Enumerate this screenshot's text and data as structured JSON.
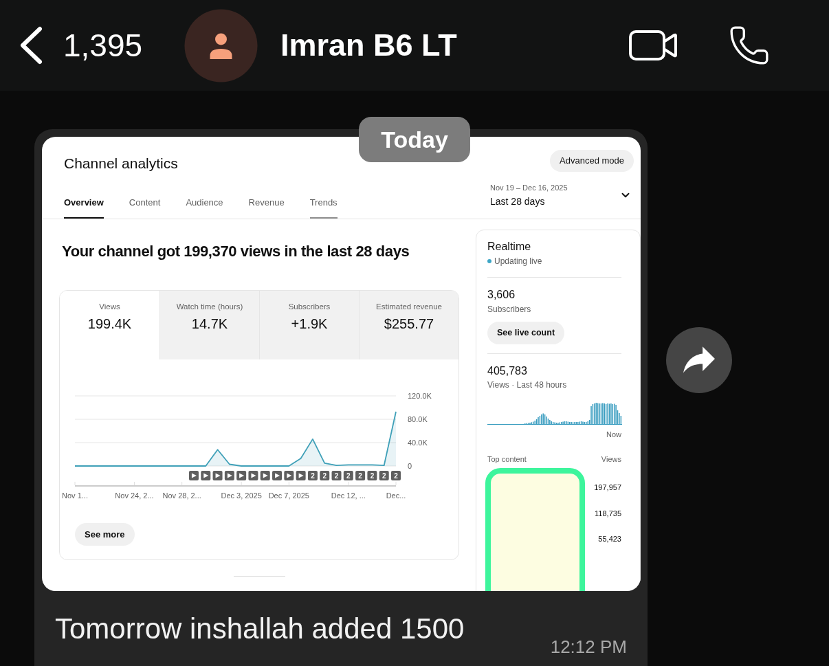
{
  "chat_header": {
    "back_count": "1,395",
    "contact_name": "Imran B6 LT"
  },
  "date_chip": "Today",
  "message": {
    "analytics_screenshot": {
      "title": "Channel analytics",
      "advanced_mode_button": "Advanced mode",
      "date_range": {
        "dates": "Nov 19 – Dec 16, 2025",
        "period": "Last 28 days"
      },
      "tabs": [
        {
          "label": "Overview",
          "selected": true,
          "hovered": false
        },
        {
          "label": "Content",
          "selected": false,
          "hovered": false
        },
        {
          "label": "Audience",
          "selected": false,
          "hovered": false
        },
        {
          "label": "Revenue",
          "selected": false,
          "hovered": false
        },
        {
          "label": "Trends",
          "selected": false,
          "hovered": true
        }
      ],
      "headline": "Your channel got 199,370 views in the last 28 days",
      "metrics": [
        {
          "label": "Views",
          "value": "199.4K",
          "selected": true
        },
        {
          "label": "Watch time (hours)",
          "value": "14.7K",
          "selected": false
        },
        {
          "label": "Subscribers",
          "value": "+1.9K",
          "selected": false
        },
        {
          "label": "Estimated revenue",
          "value": "$255.77",
          "selected": false
        }
      ],
      "chart_data": {
        "type": "area",
        "categories": [
          "Nov 1...",
          null,
          null,
          null,
          null,
          "Nov 24, 2...",
          null,
          null,
          null,
          "Nov 28, 2...",
          null,
          null,
          null,
          null,
          "Dec 3, 2025",
          null,
          null,
          null,
          "Dec 7, 2025",
          null,
          null,
          null,
          null,
          "Dec 12, ...",
          null,
          null,
          null,
          "Dec..."
        ],
        "series": [
          {
            "color": "#3fa0b8",
            "values": [
              0,
              0,
              0,
              0,
              0,
              0,
              0,
              0,
              0,
              0,
              0,
              0,
              28000,
              3000,
              0,
              0,
              0,
              0,
              0,
              13000,
              46000,
              5000,
              1000,
              2000,
              2000,
              2000,
              1000,
              93000
            ]
          }
        ],
        "ylim": [
          0,
          120000
        ],
        "yticks": [
          {
            "value": 0,
            "label": "0"
          },
          {
            "value": 40000,
            "label": "40.0K"
          },
          {
            "value": 80000,
            "label": "80.0K"
          },
          {
            "value": 120000,
            "label": "120.0K"
          }
        ]
      },
      "publish_markers": [
        {
          "kind": "video"
        },
        {
          "kind": "video"
        },
        {
          "kind": "video"
        },
        {
          "kind": "video"
        },
        {
          "kind": "video"
        },
        {
          "kind": "video"
        },
        {
          "kind": "video"
        },
        {
          "kind": "video"
        },
        {
          "kind": "video"
        },
        {
          "kind": "video"
        },
        {
          "kind": "count",
          "label": "2"
        },
        {
          "kind": "count",
          "label": "2"
        },
        {
          "kind": "count",
          "label": "2"
        },
        {
          "kind": "count",
          "label": "2"
        },
        {
          "kind": "count",
          "label": "2"
        },
        {
          "kind": "count",
          "label": "2"
        },
        {
          "kind": "count",
          "label": "2"
        },
        {
          "kind": "count",
          "label": "2"
        }
      ],
      "see_more_button": "See more",
      "realtime": {
        "title": "Realtime",
        "status": "Updating live",
        "subscribers": {
          "value": "3,606",
          "label": "Subscribers"
        },
        "live_count_button": "See live count",
        "views": {
          "value": "405,783",
          "label": "Views · Last 48 hours"
        },
        "sparkline_end_label": "Now",
        "top_content": {
          "heading": "Top content",
          "views_heading": "Views",
          "rows": [
            {
              "views": "197,957"
            },
            {
              "views": "118,735"
            },
            {
              "views": "55,423"
            }
          ]
        }
      }
    },
    "caption": "Tomorrow inshallah added 1500",
    "time": "12:12 PM"
  }
}
